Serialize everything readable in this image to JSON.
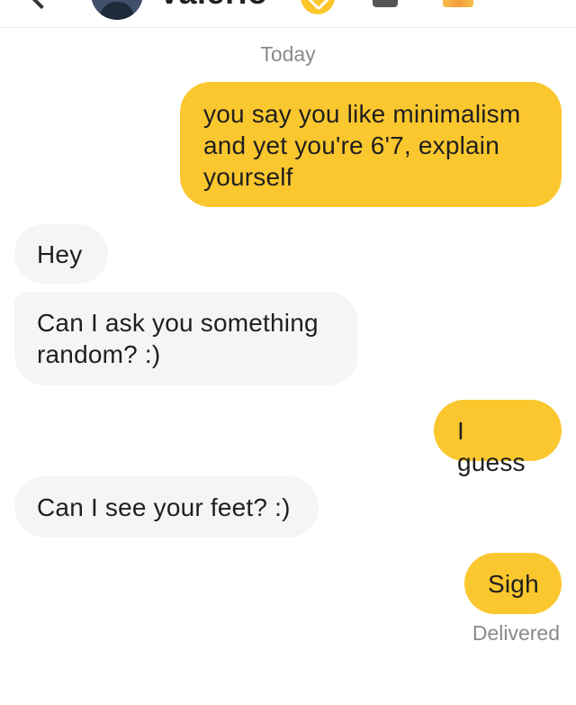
{
  "header": {
    "contact_name": "Valerio",
    "icons": [
      "back-icon",
      "avatar",
      "badge-icon",
      "video-icon",
      "emoji-icon",
      "more-icon"
    ]
  },
  "conversation": {
    "date_label": "Today",
    "messages": [
      {
        "sender": "me",
        "text": "you say you like minimalism and yet you're 6'7, explain yourself"
      },
      {
        "sender": "them",
        "text": "Hey"
      },
      {
        "sender": "them",
        "text": "Can I ask you something random? :)"
      },
      {
        "sender": "me",
        "text": "I guess"
      },
      {
        "sender": "them",
        "text": "Can I see your feet? :)"
      },
      {
        "sender": "me",
        "text": "Sigh"
      }
    ],
    "status": "Delivered"
  },
  "colors": {
    "sent_bubble": "#fbc72e",
    "received_bubble": "#f5f5f7",
    "meta_text": "#8a8a8a"
  }
}
